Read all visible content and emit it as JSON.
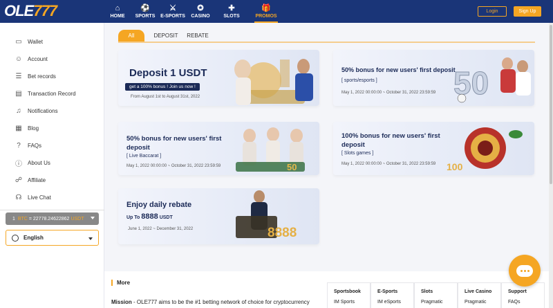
{
  "header": {
    "logo_part1": "OLE",
    "logo_part2": "777",
    "nav": [
      {
        "label": "HOME",
        "icon": "home-icon"
      },
      {
        "label": "SPORTS",
        "icon": "soccer-ball-icon"
      },
      {
        "label": "E-SPORTS",
        "icon": "swords-icon"
      },
      {
        "label": "CASINO",
        "icon": "poker-chip-icon"
      },
      {
        "label": "SLOTS",
        "icon": "gamepad-icon"
      },
      {
        "label": "PROMOS",
        "icon": "gift-icon"
      }
    ],
    "active_nav": "PROMOS",
    "login_label": "Login",
    "signup_label": "Sign Up"
  },
  "sidebar": {
    "items": [
      {
        "label": "Wallet",
        "icon": "wallet-icon"
      },
      {
        "label": "Account",
        "icon": "user-icon"
      },
      {
        "label": "Bet records",
        "icon": "document-icon"
      },
      {
        "label": "Transaction Record",
        "icon": "receipt-icon"
      },
      {
        "label": "Notifications",
        "icon": "bell-icon"
      },
      {
        "label": "Blog",
        "icon": "blog-icon"
      },
      {
        "label": "FAQs",
        "icon": "question-icon"
      },
      {
        "label": "About Us",
        "icon": "info-icon"
      },
      {
        "label": "Affiliate",
        "icon": "affiliate-icon"
      },
      {
        "label": "Live Chat",
        "icon": "headset-icon"
      }
    ],
    "rate_prefix": "1",
    "rate_from": "BTC",
    "rate_eq": "= 22778.24622862",
    "rate_to": "USDT",
    "language": "English"
  },
  "tabs": [
    "All",
    "DEPOSIT",
    "REBATE"
  ],
  "active_tab": "All",
  "promos": [
    {
      "title": "Deposit 1 USDT",
      "subtitle": "get a 100% bonus ! Join us now !",
      "date": "From August 1st to August 31st, 2022"
    },
    {
      "title": "50% bonus for new users' first deposit",
      "subtitle": "[ sports/esports ]",
      "date": "May 1, 2022 00:00:00 ~ October 31, 2022 23:59:59"
    },
    {
      "title": "50% bonus for new users' first deposit",
      "subtitle": "[ Live Baccarat ]",
      "date": "May 1, 2022 00:00:00 ~ October 31, 2022 23:59:59"
    },
    {
      "title": "100% bonus for new users' first deposit",
      "subtitle": "[ Slots games ]",
      "date": "May 1, 2022 00:00:00 ~ October 31, 2022 23:59:59"
    },
    {
      "title": "Enjoy daily rebate",
      "subtitle_prefix": "Up To",
      "subtitle_amount": "8888",
      "subtitle_unit": "USDT",
      "date": "June 1, 2022 ~ December 31, 2022"
    }
  ],
  "footer": {
    "more_label": "More",
    "mission_label": "Mission",
    "mission_text": " - OLE777 aims to be the #1 betting network of choice for cryptocurrency",
    "columns": [
      {
        "heading": "Sportsbook",
        "first": "IM Sports"
      },
      {
        "heading": "E-Sports",
        "first": "IM eSports"
      },
      {
        "heading": "Slots",
        "first": "Pragmatic"
      },
      {
        "heading": "Live Casino",
        "first": "Pragmatic"
      },
      {
        "heading": "Support",
        "first": "FAQs"
      }
    ]
  },
  "colors": {
    "navy": "#1a3578",
    "accent": "#f5a623"
  }
}
